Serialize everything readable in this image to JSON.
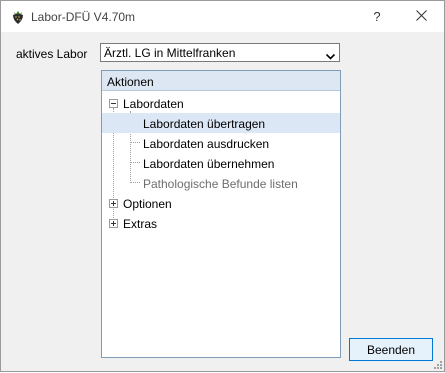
{
  "window": {
    "title": "Labor-DFÜ V4.70m",
    "help_label": "?"
  },
  "labor": {
    "label": "aktives Labor",
    "selected": "Ärztl. LG in Mittelfranken"
  },
  "tree": {
    "header": "Aktionen",
    "nodes": [
      {
        "label": "Labordaten",
        "expanded": true,
        "children": [
          {
            "label": "Labordaten übertragen",
            "selected": true,
            "enabled": true
          },
          {
            "label": "Labordaten ausdrucken",
            "enabled": true
          },
          {
            "label": "Labordaten übernehmen",
            "enabled": true
          },
          {
            "label": "Pathologische Befunde listen",
            "enabled": false
          }
        ]
      },
      {
        "label": "Optionen",
        "expanded": false
      },
      {
        "label": "Extras",
        "expanded": false
      }
    ]
  },
  "buttons": {
    "end_label": "Beenden"
  },
  "colors": {
    "selection": "#dce7f6",
    "header_bg": "#dde6f3",
    "disabled_text": "#6d6d6d",
    "button_border": "#0078d7"
  }
}
